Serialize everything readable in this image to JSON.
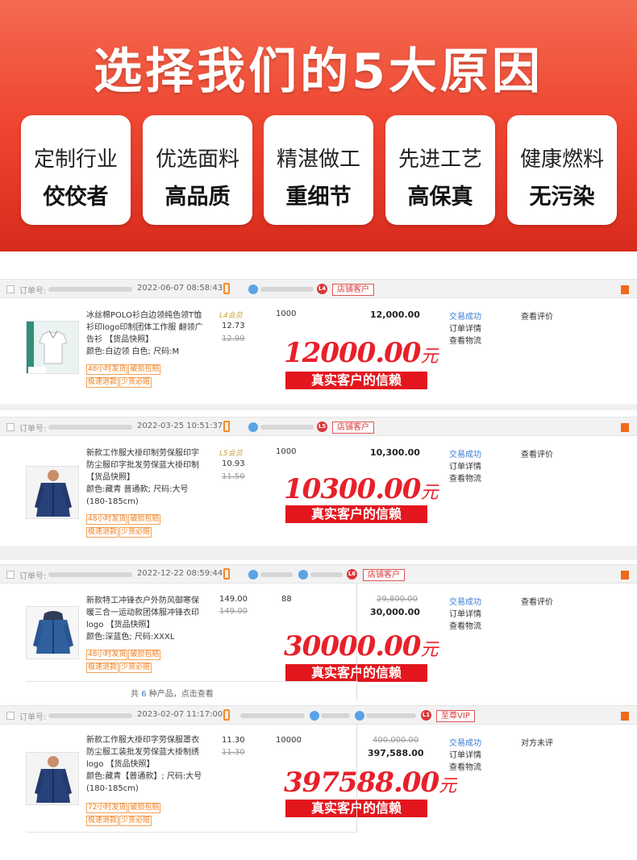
{
  "banner": {
    "title": "选择我们的5大原因",
    "features": [
      {
        "line1": "定制行业",
        "line2": "佼佼者"
      },
      {
        "line1": "优选面料",
        "line2": "高品质"
      },
      {
        "line1": "精湛做工",
        "line2": "重细节"
      },
      {
        "line1": "先进工艺",
        "line2": "高保真"
      },
      {
        "line1": "健康燃料",
        "line2": "无污染"
      }
    ]
  },
  "orders": [
    {
      "order_label": "订单号:",
      "date": "2022-06-07 08:58:43",
      "level_badge": "L4",
      "customer_tag": "店铺客户",
      "title": "冰丝棉POLO衫白边领纯色领T恤衫印logo印制团体工作服 翻领广告衫 【货品快照】",
      "spec": "颜色:白边领 白色; 尺码:M",
      "tags1": [
        "48小时发货",
        "破损包赔"
      ],
      "tags2": [
        "极速退款",
        "少货必赔"
      ],
      "member": "L4会员",
      "price": "12.73",
      "orig_price": "12.99",
      "qty": "1000",
      "total_orig": "",
      "total": "12,000.00",
      "status": "交易成功",
      "detail": "订单详情",
      "logistics": "查看物流",
      "review": "查看评价",
      "big_amount": "12000.00",
      "big_unit": "元",
      "trust": "真实客户的信赖"
    },
    {
      "order_label": "订单号:",
      "date": "2022-03-25 10:51:37",
      "level_badge": "L5",
      "customer_tag": "店铺客户",
      "title": "新款工作服大褂印制劳保服印字防尘服印字批发劳保蓝大褂印制 【货品快照】",
      "spec": "颜色:藏青 普通款; 尺码:大号(180-185cm)",
      "tags1": [
        "48小时发货",
        "破损包赔"
      ],
      "tags2": [
        "极速退款",
        "少货必赔"
      ],
      "member": "L5会员",
      "price": "10.93",
      "orig_price": "11.50",
      "qty": "1000",
      "total_orig": "",
      "total": "10,300.00",
      "status": "交易成功",
      "detail": "订单详情",
      "logistics": "查看物流",
      "review": "查看评价",
      "big_amount": "10300.00",
      "big_unit": "元",
      "trust": "真实客户的信赖"
    },
    {
      "order_label": "订单号:",
      "date": "2022-12-22 08:59:44",
      "level_badge": "L6",
      "customer_tag": "店铺客户",
      "title": "新款特工冲锋衣户外防风御寒保暖三合一运动款团体服冲锋衣印logo 【货品快照】",
      "spec": "颜色:深蓝色; 尺码:XXXL",
      "tags1": [
        "48小时发货",
        "破损包赔"
      ],
      "tags2": [
        "极速退款",
        "少货必赔"
      ],
      "member": "",
      "price": "149.00",
      "orig_price": "149.00",
      "qty": "88",
      "total_orig": "29,800.00",
      "total": "30,000.00",
      "status": "交易成功",
      "detail": "订单详情",
      "logistics": "查看物流",
      "review": "查看评价",
      "big_amount": "30000.00",
      "big_unit": "元",
      "trust": "真实客户的信赖",
      "count_prefix": "共",
      "count_n": "6",
      "count_suffix": "种产品，点击查看"
    },
    {
      "order_label": "订单号:",
      "date": "2023-02-07 11:17:00",
      "level_badge": "L1",
      "customer_tag": "至尊VIP",
      "title": "新款工作服大褂印字劳保服罩衣防尘服工装批发劳保蓝大褂制绣logo 【货品快照】",
      "spec": "颜色:藏青【普通款】; 尺码:大号(180-185cm)",
      "tags1": [
        "72小时发货",
        "破损包赔"
      ],
      "tags2": [
        "极速退款",
        "少货必赔"
      ],
      "member": "",
      "price": "11.30",
      "orig_price": "11.30",
      "qty": "10000",
      "total_orig": "400,000.00",
      "total": "397,588.00",
      "status": "交易成功",
      "detail": "订单详情",
      "logistics": "查看物流",
      "review": "对方未评",
      "big_amount": "397588.00",
      "big_unit": "元",
      "trust": "真实客户的信赖"
    }
  ],
  "icons": [
    "checkbox-icon",
    "phone-icon",
    "user-avatar-icon",
    "level-badge-icon",
    "bookmark-icon"
  ],
  "colors": {
    "banner_red": "#ee4530",
    "accent_red": "#e3161e",
    "link_blue": "#3a7bd5",
    "tag_orange": "#f07d1a"
  }
}
